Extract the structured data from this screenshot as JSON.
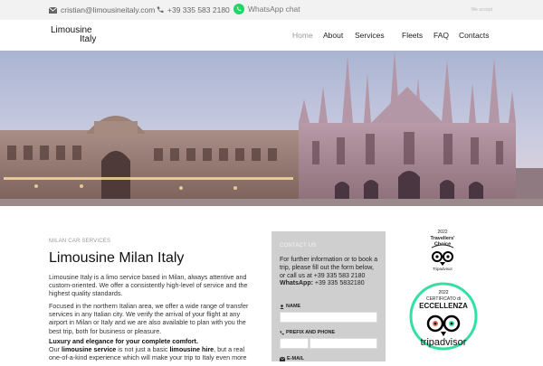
{
  "topbar": {
    "email": "cristian@limousineitaly.com",
    "phone": "+39 335 583 2180",
    "whatsapp": "WhatsApp chat",
    "small_link": "We accept"
  },
  "nav": {
    "logo_line1": "Limousine",
    "logo_line2": "Italy",
    "items": [
      "Home",
      "About",
      "Services",
      "Fleets",
      "FAQ",
      "Contacts"
    ],
    "active": "Home"
  },
  "main": {
    "subtitle": "MILAN CAR SERVICES",
    "title": "Limousine Milan Italy",
    "para1": "Limousine Italy is a limo service based in Milan, always attentive and custom-oriented. We offer a consistently high-level of service and the highest quality standards.",
    "para2": "Focused in the northern Italian area, we offer a wide range of transfer services in any Italian city. We verify the arrival of your flight at any airport in Milan or Italy and we are also available to plan with you the best trip, both for business or pleasure.",
    "para3_bold": "Luxury and elegance for your complete comfort.",
    "para4_a": "Our ",
    "para4_b": "limousine service",
    "para4_c": " is not just a basic ",
    "para4_d": "limousine hire",
    "para4_e": ", but a real one-of-a-kind experience which will make your trip to Italy even more"
  },
  "contact_form": {
    "heading": "CONTACT US",
    "intro": "For further information or to book a trip, please fill out the form below, or call us at +39 335 583 2180",
    "whatsapp_label": "WhatsApp:",
    "whatsapp_number": "+39 335 5832180",
    "name_label": "NAME",
    "prefix_phone_label": "PREFIX AND PHONE",
    "email_label": "E-MAIL",
    "name_value": "",
    "prefix_value": "",
    "phone_value": ""
  },
  "badges": {
    "travellers_year": "2022",
    "travellers_text1": "Travellers'",
    "travellers_text2": "Choice",
    "travellers_brand": "Tripadvisor",
    "cert_year": "2022",
    "cert_line1": "CERTIFICATO di",
    "cert_line2": "ECCELLENZA",
    "cert_brand": "tripadvisor"
  },
  "colors": {
    "topbar_bg": "#f2f2f2",
    "form_bg": "#cfcfcf",
    "whatsapp_green": "#25d366",
    "tripadvisor_green": "#34e0a1"
  }
}
